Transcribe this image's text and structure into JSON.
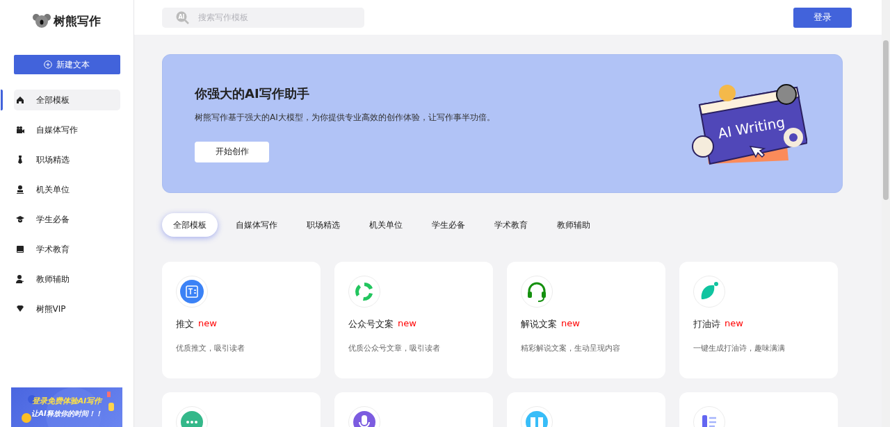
{
  "brand": {
    "name": "树熊写作"
  },
  "new_button": {
    "label": "新建文本"
  },
  "sidebar": {
    "items": [
      {
        "label": "全部模板",
        "selected": true
      },
      {
        "label": "自媒体写作",
        "selected": false
      },
      {
        "label": "职场精选",
        "selected": false
      },
      {
        "label": "机关单位",
        "selected": false
      },
      {
        "label": "学生必备",
        "selected": false
      },
      {
        "label": "学术教育",
        "selected": false
      },
      {
        "label": "教师辅助",
        "selected": false
      },
      {
        "label": "树熊VIP",
        "selected": false
      }
    ]
  },
  "promo": {
    "title": "登录免费体验AI写作",
    "subtitle": "让AI释放你的时间！！"
  },
  "search": {
    "badge": "AI",
    "placeholder": "搜索写作模板"
  },
  "login_button": {
    "label": "登录"
  },
  "hero": {
    "title": "你强大的AI写作助手",
    "description": "树熊写作基于强大的AI大模型，为你提供专业高效的创作体验，让写作事半功倍。",
    "button": "开始创作",
    "art_text": "AI Writing"
  },
  "tabs": [
    {
      "label": "全部模板",
      "selected": true
    },
    {
      "label": "自媒体写作",
      "selected": false
    },
    {
      "label": "职场精选",
      "selected": false
    },
    {
      "label": "机关单位",
      "selected": false
    },
    {
      "label": "学生必备",
      "selected": false
    },
    {
      "label": "学术教育",
      "selected": false
    },
    {
      "label": "教师辅助",
      "selected": false
    }
  ],
  "cards": [
    {
      "title": "推文",
      "badge": "new",
      "description": "优质推文，吸引读者"
    },
    {
      "title": "公众号文案",
      "badge": "new",
      "description": "优质公众号文章，吸引读者"
    },
    {
      "title": "解说文案",
      "badge": "new",
      "description": "精彩解说文案，生动呈现内容"
    },
    {
      "title": "打油诗",
      "badge": "new",
      "description": "一键生成打油诗，趣味满满"
    }
  ]
}
